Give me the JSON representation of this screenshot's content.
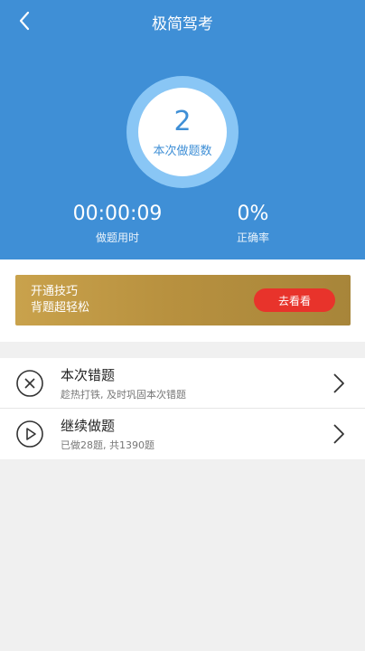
{
  "header": {
    "title": "极简驾考",
    "count": "2",
    "count_label": "本次做题数",
    "time_value": "00:00:09",
    "time_label": "做题用时",
    "accuracy_value": "0%",
    "accuracy_label": "正确率"
  },
  "promo": {
    "line1": "开通技巧",
    "line2": "背题超轻松",
    "button": "去看看"
  },
  "list": [
    {
      "title": "本次错题",
      "subtitle": "趁热打铁, 及时巩固本次错题"
    },
    {
      "title": "继续做题",
      "subtitle": "已做28题, 共1390题"
    }
  ],
  "colors": {
    "primary": "#3f8fd6",
    "ring": "#89c6f5",
    "button": "#e8332b",
    "gold": "#b8913f"
  }
}
